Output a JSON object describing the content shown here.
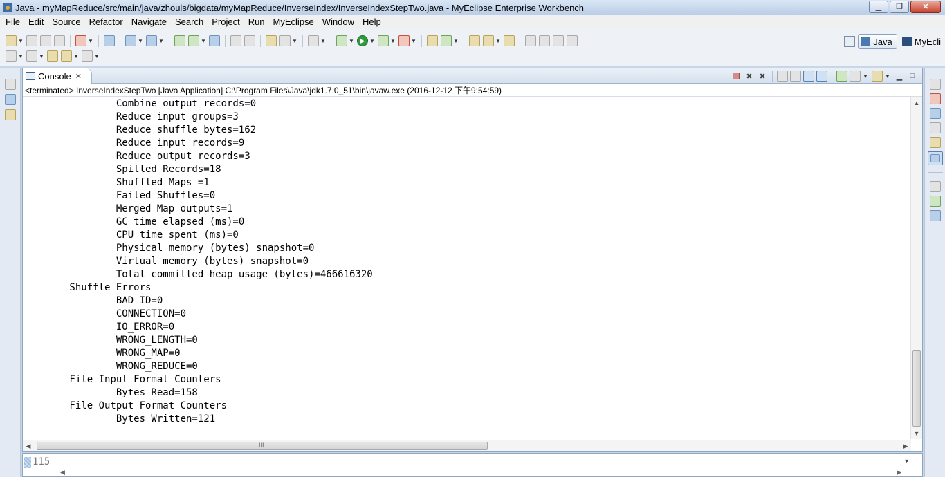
{
  "window": {
    "title": "Java - myMapReduce/src/main/java/zhouls/bigdata/myMapReduce/InverseIndex/InverseIndexStepTwo.java - MyEclipse Enterprise Workbench",
    "minimize_glyph": "▁",
    "maximize_glyph": "❐",
    "close_glyph": "✕"
  },
  "menu": [
    "File",
    "Edit",
    "Source",
    "Refactor",
    "Navigate",
    "Search",
    "Project",
    "Run",
    "MyEclipse",
    "Window",
    "Help"
  ],
  "perspectives": {
    "java_label": "Java",
    "myeclipse_label": "MyEcli"
  },
  "console_view": {
    "tab_label": "Console",
    "tab_close": "✕",
    "status_line": "<terminated> InverseIndexStepTwo [Java Application] C:\\Program Files\\Java\\jdk1.7.0_51\\bin\\javaw.exe (2016-12-12 下午9:54:59)",
    "lines": [
      "\t\tCombine output records=0",
      "\t\tReduce input groups=3",
      "\t\tReduce shuffle bytes=162",
      "\t\tReduce input records=9",
      "\t\tReduce output records=3",
      "\t\tSpilled Records=18",
      "\t\tShuffled Maps =1",
      "\t\tFailed Shuffles=0",
      "\t\tMerged Map outputs=1",
      "\t\tGC time elapsed (ms)=0",
      "\t\tCPU time spent (ms)=0",
      "\t\tPhysical memory (bytes) snapshot=0",
      "\t\tVirtual memory (bytes) snapshot=0",
      "\t\tTotal committed heap usage (bytes)=466616320",
      "\tShuffle Errors",
      "\t\tBAD_ID=0",
      "\t\tCONNECTION=0",
      "\t\tIO_ERROR=0",
      "\t\tWRONG_LENGTH=0",
      "\t\tWRONG_MAP=0",
      "\t\tWRONG_REDUCE=0",
      "\tFile Input Format Counters",
      "\t\tBytes Read=158",
      "\tFile Output Format Counters",
      "\t\tBytes Written=121"
    ],
    "hscroll_grip": "III"
  },
  "editor_strip": {
    "line_number": "115"
  },
  "icons": {
    "scroll_up": "▲",
    "scroll_down": "▼",
    "scroll_left": "◀",
    "scroll_right": "▶",
    "dropdown": "▼"
  }
}
